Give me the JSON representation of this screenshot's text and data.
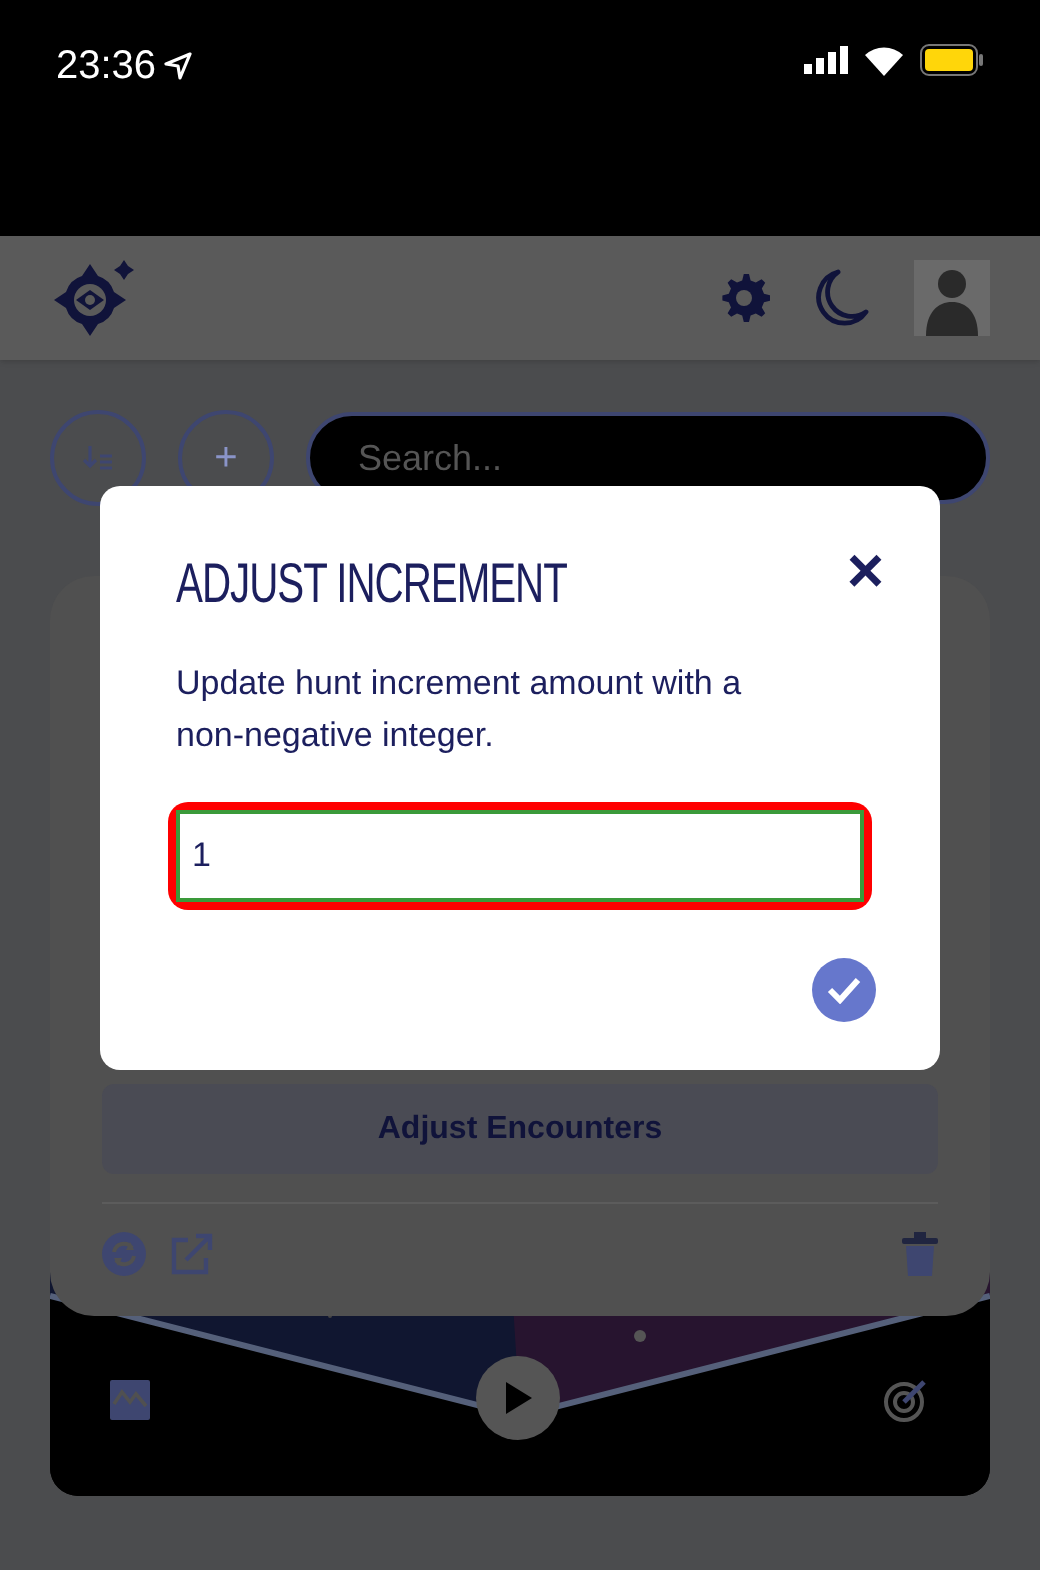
{
  "status_bar": {
    "time": "23:36"
  },
  "toolbar": {
    "search": {
      "placeholder": "Search..."
    },
    "add_button": "+"
  },
  "hunt_card": {
    "adjust_button": "Adjust Encounters"
  },
  "dialog": {
    "title": "ADJUST INCREMENT",
    "message": "Update hunt increment amount with a non-negative integer.",
    "input": {
      "value": "1",
      "highlighted": true
    },
    "close": "×"
  }
}
